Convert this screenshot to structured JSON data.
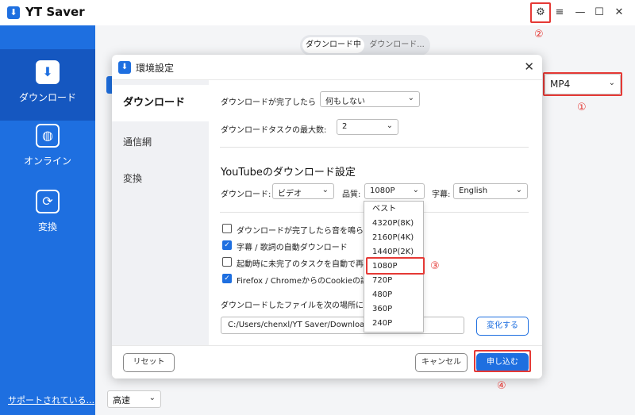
{
  "app": {
    "title": "YT Saver",
    "logo_icon": "download-icon"
  },
  "window_controls": {
    "settings": "⚙",
    "menu": "≡",
    "minimize": "—",
    "maximize": "☐",
    "close": "✕"
  },
  "callouts": {
    "c1": "①",
    "c2": "②",
    "c3": "③",
    "c4": "④"
  },
  "sidebar": {
    "items": [
      {
        "label": "ダウンロード",
        "icon": "download-icon"
      },
      {
        "label": "オンライン",
        "icon": "globe-icon"
      },
      {
        "label": "変換",
        "icon": "convert-icon"
      }
    ],
    "support_link": "サポートされている..."
  },
  "main": {
    "tabs": [
      "ダウンロード中",
      "ダウンロード..."
    ],
    "format_value": "MP4",
    "speed_value": "高速"
  },
  "dialog": {
    "title": "環境設定",
    "nav": [
      "ダウンロード",
      "通信網",
      "変換"
    ],
    "after_complete_label": "ダウンロードが完了したら",
    "after_complete_value": "何もしない",
    "max_tasks_label": "ダウンロードタスクの最大数:",
    "max_tasks_value": "2",
    "youtube_section_title": "YouTubeのダウンロード設定",
    "download_type_label": "ダウンロード:",
    "download_type_value": "ビデオ",
    "quality_label": "品質:",
    "quality_value": "1080P",
    "subtitle_label": "字幕:",
    "subtitle_value": "English",
    "checkboxes": [
      {
        "label": "ダウンロードが完了したら音を鳴らす",
        "checked": false
      },
      {
        "label": "字幕 / 歌詞の自動ダウンロード",
        "checked": true
      },
      {
        "label": "起動時に未完了のタスクを自動で再開",
        "checked": false
      },
      {
        "label": "Firefox / ChromeからのCookieの読み",
        "checked": true
      }
    ],
    "save_location_label": "ダウンロードしたファイルを次の場所に保",
    "save_path": "C:/Users/chenxl/YT Saver/Download",
    "change_button": "変化する",
    "reset_button": "リセット",
    "cancel_button": "キャンセル",
    "apply_button": "申し込む",
    "quality_options": [
      "ベスト",
      "4320P(8K)",
      "2160P(4K)",
      "1440P(2K)",
      "1080P",
      "720P",
      "480P",
      "360P",
      "240P"
    ],
    "quality_selected": "1080P"
  },
  "colors": {
    "accent": "#1e6fe0",
    "callout": "#e53935"
  }
}
